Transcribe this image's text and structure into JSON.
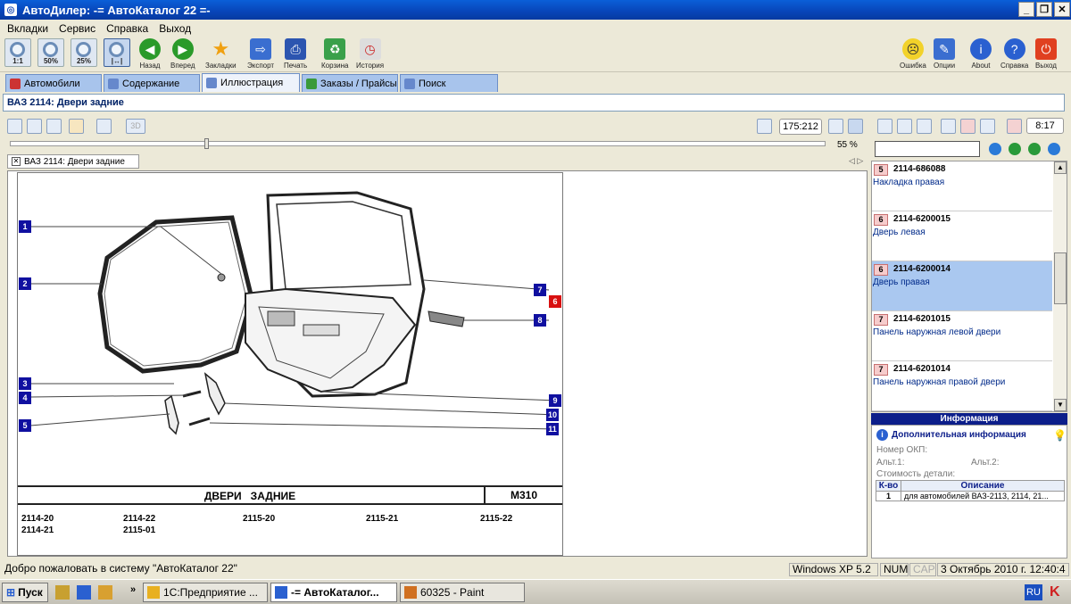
{
  "window": {
    "title": "АвтоДилер: -= АвтоКаталог 22 =-"
  },
  "menu": [
    "Вкладки",
    "Сервис",
    "Справка",
    "Выход"
  ],
  "toolbar": {
    "zoom": [
      "1:1",
      "50%",
      "25%",
      ""
    ],
    "buttons": [
      "Назад",
      "Вперед",
      "Закладки",
      "Экспорт",
      "Печать",
      "Корзина",
      "История"
    ],
    "right": [
      "Ошибка",
      "Опции",
      "About",
      "Справка",
      "Выход"
    ]
  },
  "tabs": [
    "Автомобили",
    "Содержание",
    "Иллюстрация",
    "Заказы / Прайсы",
    "Поиск"
  ],
  "path": "ВАЗ 2114: Двери задние",
  "viewer": {
    "coords": "175:212",
    "zoom_percent": "55 %",
    "zoom_value": 0.24,
    "doc_tab": "ВАЗ 2114: Двери задние",
    "btn3d": "3D"
  },
  "drawing": {
    "callouts": [
      "1",
      "2",
      "3",
      "4",
      "5",
      "6",
      "7",
      "8",
      "9",
      "10",
      "11"
    ],
    "title": "ДВЕРИ   ЗАДНИЕ",
    "code": "M310",
    "models": [
      "2114-20",
      "2114-22",
      "2115-20",
      "2115-21",
      "2115-22",
      "2114-21",
      "2115-01"
    ]
  },
  "right": {
    "counter": "8:17",
    "parts": [
      {
        "qty": "5",
        "code": "2114-686088",
        "name": "Накладка правая"
      },
      {
        "qty": "6",
        "code": "2114-6200015",
        "name": "Дверь левая"
      },
      {
        "qty": "6",
        "code": "2114-6200014",
        "name": "Дверь правая"
      },
      {
        "qty": "7",
        "code": "2114-6201015",
        "name": "Панель наружная левой двери"
      },
      {
        "qty": "7",
        "code": "2114-6201014",
        "name": "Панель наружная правой двери"
      }
    ],
    "info_header": "Информация",
    "info_title": "Дополнительная информация",
    "okp": "Номер ОКП:",
    "alt1": "Альт.1:",
    "alt2": "Альт.2:",
    "cost": "Стоимость детали:",
    "table_headers": [
      "К-во",
      "Описание"
    ],
    "table_rows": [
      {
        "qty": "1",
        "desc": "для автомобилей ВАЗ-2113, 2114, 21..."
      }
    ]
  },
  "status": {
    "message": "Добро пожаловать в систему \"АвтоКаталог 22\"",
    "os": "Windows XP 5.2",
    "num": "NUM",
    "caps": "CAPS",
    "datetime": "3 Октябрь 2010 г. 12:40:4"
  },
  "taskbar": {
    "start": "Пуск",
    "tasks": [
      "1С:Предприятие ...",
      "-= АвтоКаталог...",
      "60325 - Paint"
    ],
    "lang": "RU",
    "chevron": "»"
  }
}
